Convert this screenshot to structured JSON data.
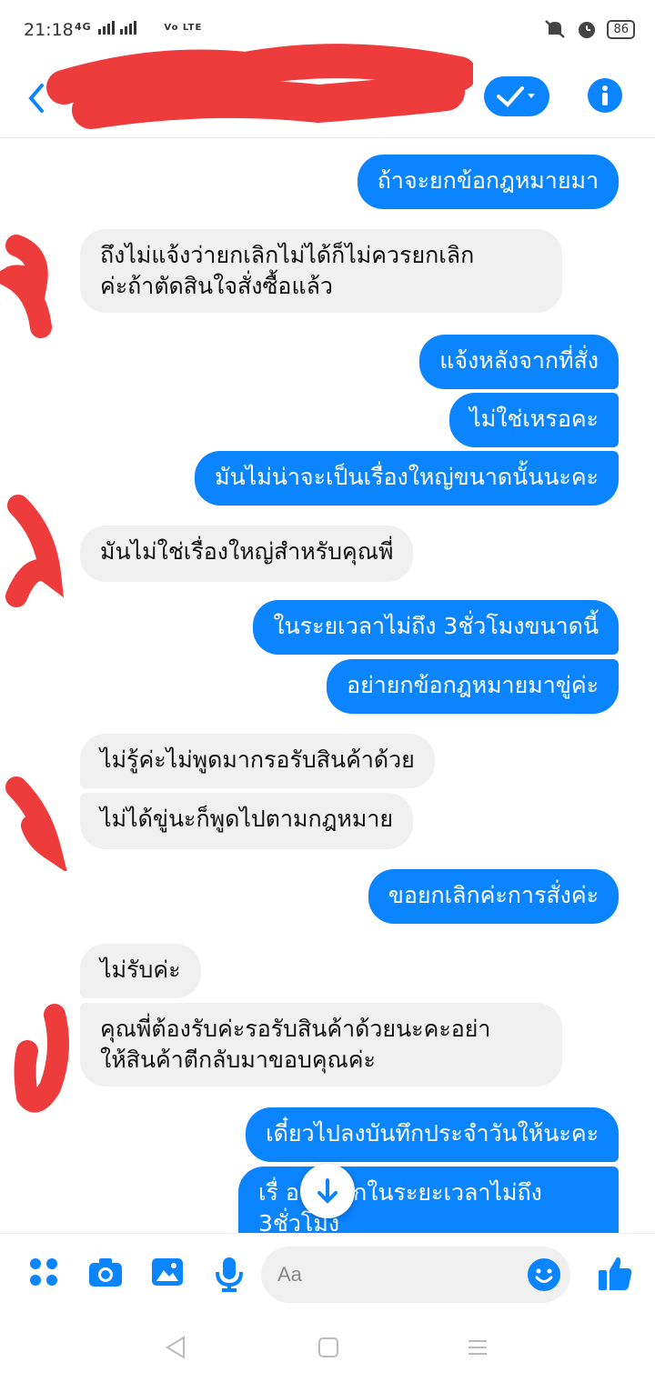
{
  "status_bar": {
    "time": "21:18",
    "network": "4G",
    "carrier_badge": "Vo LTE",
    "battery": "86"
  },
  "header": {
    "contact_name": "",
    "icons": [
      "back-icon",
      "check-dropdown-icon",
      "info-icon"
    ]
  },
  "messages": [
    {
      "side": "out",
      "text": "ถ้าจะยกข้อกฎหมายมา"
    },
    {
      "side": "in",
      "text": "ถึงไม่แจ้งว่ายกเลิกไม่ได้ก็ไม่ควรยกเลิก\nค่ะถ้าตัดสินใจสั่งซื้อแล้ว"
    },
    {
      "side": "out",
      "text": "แจ้งหลังจากที่สั่ง"
    },
    {
      "side": "out",
      "text": "ไม่ใช่เหรอคะ"
    },
    {
      "side": "out",
      "text": "มันไม่น่าจะเป็นเรื่องใหญ่ขนาดนั้นนะคะ"
    },
    {
      "side": "in",
      "text": "มันไม่ใช่เรื่องใหญ่สำหรับคุณพี่"
    },
    {
      "side": "out",
      "text": "ในระยเวลาไม่ถึง 3ชั่วโมงขนาดนี้"
    },
    {
      "side": "out",
      "text": "อย่ายกข้อกฎหมายมาขู่ค่ะ"
    },
    {
      "side": "in",
      "text": "ไม่รู้ค่ะไม่พูดมากรอรับสินค้าด้วย"
    },
    {
      "side": "in",
      "text": "ไม่ได้ขู่นะก็พูดไปตามกฎหมาย"
    },
    {
      "side": "out",
      "text": "ขอยกเลิกค่ะการสั่งค่ะ"
    },
    {
      "side": "in",
      "text": "ไม่รับค่ะ"
    },
    {
      "side": "in",
      "text": "คุณพี่ต้องรับค่ะรอรับสินค้าด้วยนะคะอย่า\nให้สินค้าตีกลับมาขอบคุณค่ะ"
    },
    {
      "side": "out",
      "text": "เดี๋ยวไปลงบันทึกประจำวันให้นะคะ"
    },
    {
      "side": "out",
      "text": "เรื่ อง  กเลิกในระยะเวลาไม่ถึง\n3ชั่วโมง"
    }
  ],
  "composer": {
    "placeholder": "Aa",
    "icons": [
      "apps-icon",
      "camera-icon",
      "gallery-icon",
      "microphone-icon",
      "emoji-icon",
      "thumbs-up-icon"
    ]
  },
  "colors": {
    "accent": "#0a84ff",
    "incoming_bubble": "#f0f0f0",
    "redaction": "#ee3b3b"
  }
}
